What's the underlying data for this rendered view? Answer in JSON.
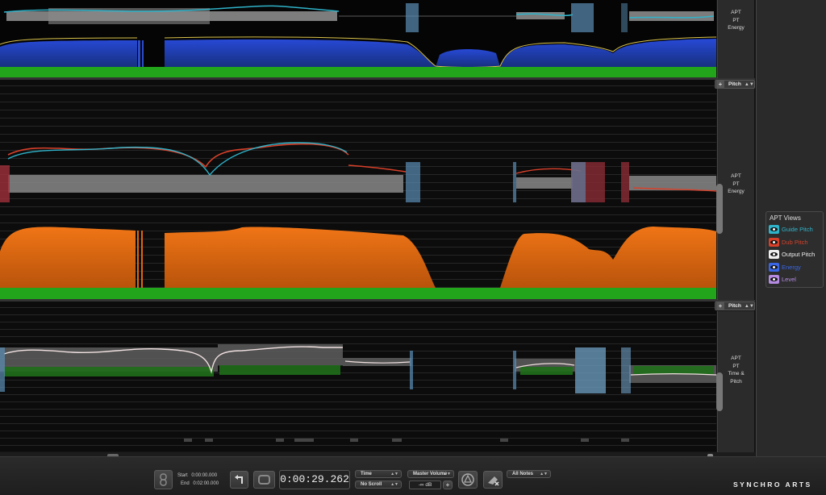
{
  "app": {
    "brand": "SYNCHRO ARTS"
  },
  "tracks": [
    {
      "label": "APT\nPT\nEnergy"
    },
    {
      "label": "APT\nPT\nEnergy",
      "dropdown": "Pitch"
    },
    {
      "label": "APT\nPT\nTime &\nPitch",
      "dropdown": "Pitch"
    }
  ],
  "apt_views": {
    "title": "APT Views",
    "items": [
      {
        "label": "Guide Pitch",
        "color": "#2fb3c9"
      },
      {
        "label": "Dub Pitch",
        "color": "#d8402a"
      },
      {
        "label": "Output Pitch",
        "color": "#eeeeee"
      },
      {
        "label": "Energy",
        "color": "#3a66e6"
      },
      {
        "label": "Level",
        "color": "#b48be0"
      }
    ]
  },
  "transport": {
    "start_label": "Start",
    "start_value": "0:00:00.000",
    "end_label": "End",
    "end_value": "0:02:00.000",
    "time": "0:00:29.262",
    "time_mode": "Time",
    "scroll_mode": "No Scroll",
    "master_volume_label": "Master Volume",
    "volume_value": "-∞ dB",
    "notes_mode": "All Notes"
  },
  "colors": {
    "energy_blue": "#1f3fb8",
    "energy_orange": "#e0660f",
    "baseline_green": "#22a51a",
    "guide_pitch": "#2fb3c9",
    "dub_pitch": "#d8402a"
  }
}
